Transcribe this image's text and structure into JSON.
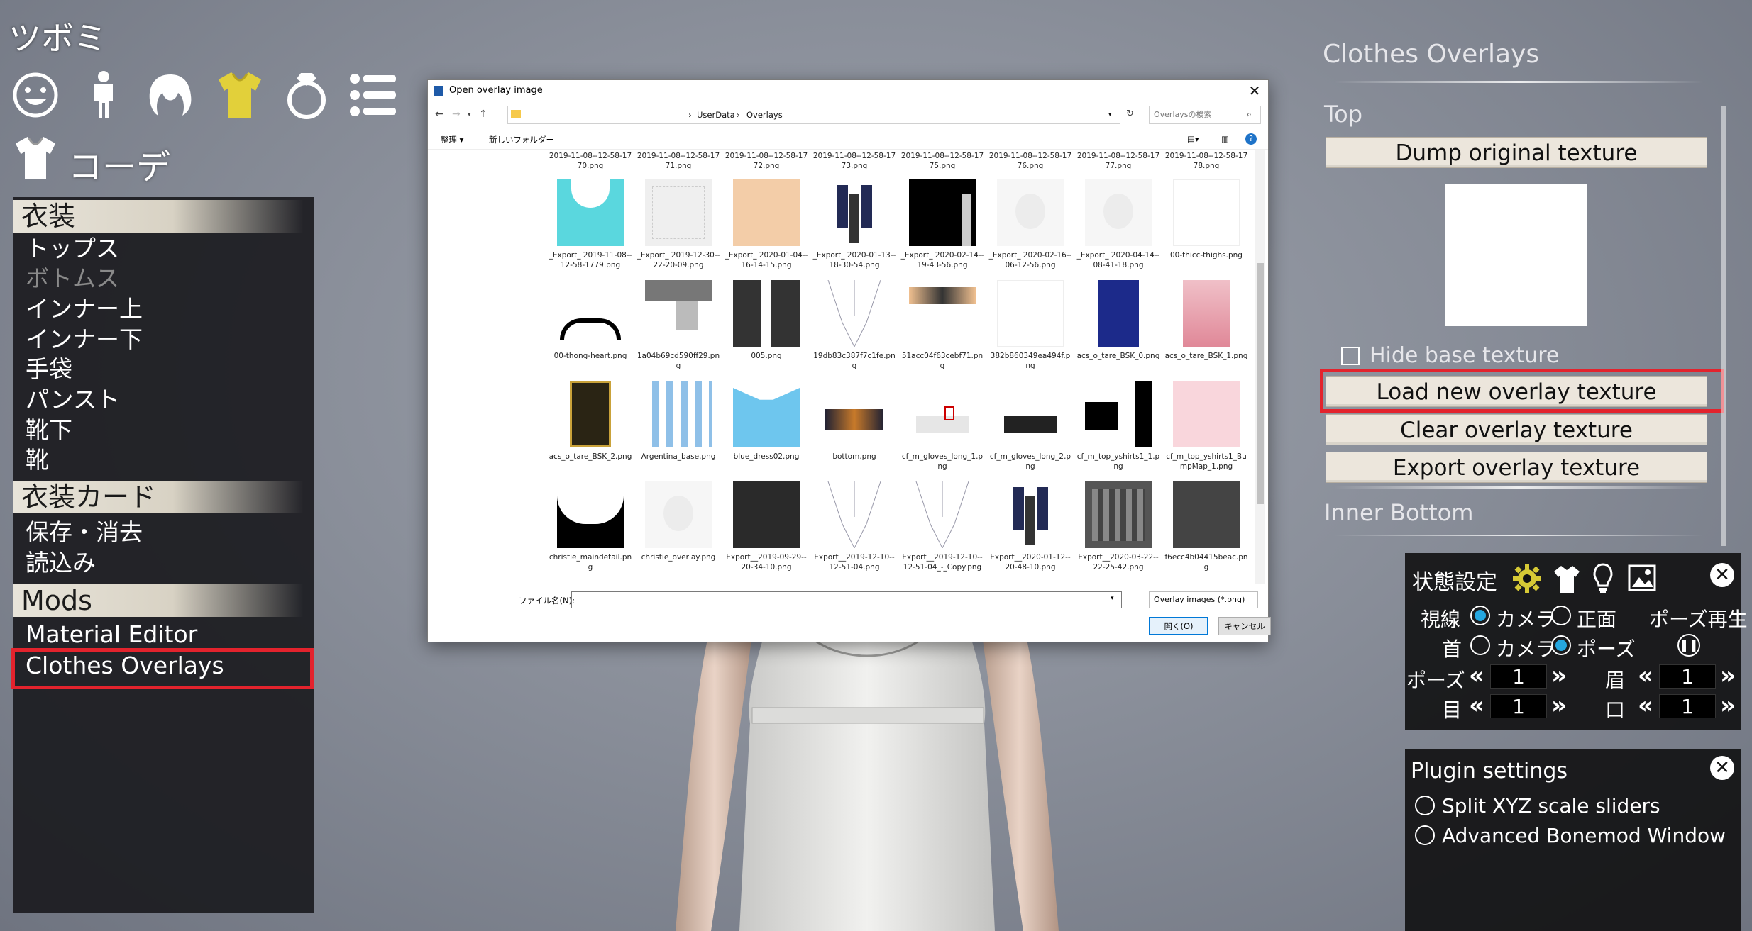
{
  "game": {
    "title": "ツボミ"
  },
  "top_icons": [
    "face-icon",
    "body-icon",
    "hair-icon",
    "clothes-icon",
    "accessory-icon",
    "list-icon"
  ],
  "coord_label": "コーデ",
  "left_menu": {
    "sections": [
      {
        "title": "衣装",
        "items": [
          {
            "label": "トップス",
            "enabled": true
          },
          {
            "label": "ボトムス",
            "enabled": false
          },
          {
            "label": "インナー上",
            "enabled": true
          },
          {
            "label": "インナー下",
            "enabled": true
          },
          {
            "label": "手袋",
            "enabled": true
          },
          {
            "label": "パンスト",
            "enabled": true
          },
          {
            "label": "靴下",
            "enabled": true
          },
          {
            "label": "靴",
            "enabled": true
          }
        ]
      },
      {
        "title": "衣装カード",
        "items": [
          {
            "label": "保存・消去",
            "enabled": true
          },
          {
            "label": "読込み",
            "enabled": true
          }
        ]
      },
      {
        "title": "Mods",
        "items": [
          {
            "label": "Material Editor",
            "enabled": true
          },
          {
            "label": "Clothes Overlays",
            "enabled": true,
            "highlighted": true
          }
        ]
      }
    ]
  },
  "right_panel": {
    "title": "Clothes Overlays",
    "top_section": "Top",
    "dump_button": "Dump original texture",
    "hide_base_label": "Hide base texture",
    "hide_base_checked": false,
    "load_button": "Load new overlay texture",
    "clear_button": "Clear overlay texture",
    "export_button": "Export overlay texture",
    "inner_bottom_section": "Inner Bottom"
  },
  "state_panel": {
    "title": "状態設定",
    "gaze_label": "視線",
    "gaze_options": [
      "カメラ",
      "正面"
    ],
    "gaze_selected": 0,
    "neck_label": "首",
    "neck_options": [
      "カメラ",
      "ポーズ"
    ],
    "neck_selected": 1,
    "pose_play_label": "ポーズ再生",
    "pose_label": "ポーズ",
    "pose_value": "1",
    "brow_label": "眉",
    "brow_value": "1",
    "eye_label": "目",
    "eye_value": "1",
    "mouth_label": "口",
    "mouth_value": "1"
  },
  "plugin_panel": {
    "title": "Plugin settings",
    "options": [
      "Split XYZ scale sliders",
      "Advanced Bonemod Window"
    ]
  },
  "dialog": {
    "title": "Open overlay image",
    "breadcrumb": [
      "UserData",
      "Overlays"
    ],
    "search_placeholder": "Overlaysの検索",
    "organize": "整理 ▾",
    "new_folder": "新しいフォルダー",
    "top_row_names": [
      "2019-11-08--12-58-1770.png",
      "2019-11-08--12-58-1771.png",
      "2019-11-08--12-58-1772.png",
      "2019-11-08--12-58-1773.png",
      "2019-11-08--12-58-1775.png",
      "2019-11-08--12-58-1776.png",
      "2019-11-08--12-58-1777.png",
      "2019-11-08--12-58-1778.png"
    ],
    "files": [
      {
        "name": "_Export_ 2019-11-08--12-58-1779.png",
        "thumb": "cyan"
      },
      {
        "name": "_Export_ 2019-12-30--22-20-09.png",
        "thumb": "lightgrey"
      },
      {
        "name": "_Export_ 2020-01-04--16-14-15.png",
        "thumb": "peach"
      },
      {
        "name": "_Export_ 2020-01-13--18-30-54.png",
        "thumb": "outfit"
      },
      {
        "name": "_Export_ 2020-02-14--19-43-56.png",
        "thumb": "black"
      },
      {
        "name": "_Export_ 2020-02-16--06-12-56.png",
        "thumb": "face"
      },
      {
        "name": "_Export_ 2020-04-14--08-41-18.png",
        "thumb": "face"
      },
      {
        "name": "00-thicc-thighs.png",
        "thumb": "white"
      },
      {
        "name": "00-thong-heart.png",
        "thumb": "thong"
      },
      {
        "name": "1a04b69cd590ff29.png",
        "thumb": "greyblocks"
      },
      {
        "name": "005.png",
        "thumb": "suit"
      },
      {
        "name": "19db83c387f7c1fe.png",
        "thumb": "lines"
      },
      {
        "name": "51acc04f63cebf71.png",
        "thumb": "stripe"
      },
      {
        "name": "382b860349ea494f.png",
        "thumb": "white"
      },
      {
        "name": "acs_o_tare_BSK_0.png",
        "thumb": "navy"
      },
      {
        "name": "acs_o_tare_BSK_1.png",
        "thumb": "pink"
      },
      {
        "name": "acs_o_tare_BSK_2.png",
        "thumb": "gold"
      },
      {
        "name": "Argentina_base.png",
        "thumb": "argentina"
      },
      {
        "name": "blue_dress02.png",
        "thumb": "bluedress"
      },
      {
        "name": "bottom.png",
        "thumb": "bottom"
      },
      {
        "name": "cf_m_gloves_long_1.png",
        "thumb": "gloves1"
      },
      {
        "name": "cf_m_gloves_long_2.png",
        "thumb": "gloves2"
      },
      {
        "name": "cf_m_top_yshirts1_1.png",
        "thumb": "shirt"
      },
      {
        "name": "cf_m_top_yshirts1_BumpMap_1.png",
        "thumb": "lightpink"
      },
      {
        "name": "christie_maindetail.png",
        "thumb": "christie"
      },
      {
        "name": "christie_overlay.png",
        "thumb": "face"
      },
      {
        "name": "Export__2019-09-29--20-34-10.png",
        "thumb": "dark"
      },
      {
        "name": "Export__2019-12-10--12-51-04.png",
        "thumb": "lines"
      },
      {
        "name": "Export__2019-12-10--12-51-04_-_Copy.png",
        "thumb": "lines"
      },
      {
        "name": "Export__2020-01-12--20-48-10.png",
        "thumb": "outfit"
      },
      {
        "name": "Export__2020-03-22--22-25-42.png",
        "thumb": "uvgrey"
      },
      {
        "name": "f6ecc4b04415beac.png",
        "thumb": "greyface"
      }
    ],
    "filename_label": "ファイル名(N):",
    "filename_value": "",
    "filetype": "Overlay images (*.png)",
    "open_button": "開く(O)",
    "cancel_button": "キャンセル"
  }
}
